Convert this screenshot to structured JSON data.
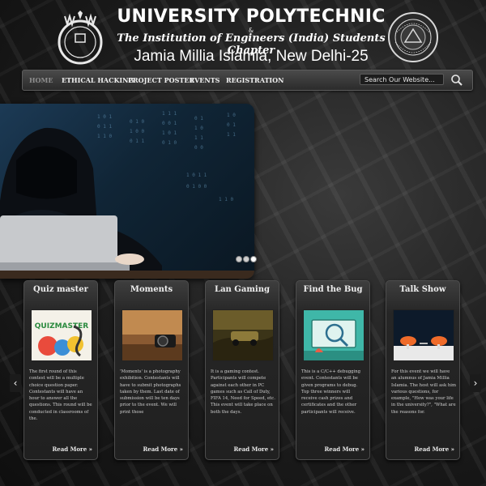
{
  "header": {
    "title": "UNIVERSITY POLYTECHNIC",
    "ampersand": "&",
    "subtitle": "The Institution of Engineers (India) Students Chapter",
    "location": "Jamia Millia Islamia, New Delhi-25"
  },
  "nav": {
    "items": [
      {
        "label": "HOME",
        "active": true
      },
      {
        "label": "ETHICAL HACKING",
        "active": false
      },
      {
        "label": "PROJECT POSTER",
        "active": false
      },
      {
        "label": "EVENTS",
        "active": false
      },
      {
        "label": "REGISTRATION",
        "active": false
      }
    ],
    "search_placeholder": "Search Our Website...",
    "search_icon": "magnifier-icon"
  },
  "slider": {
    "slide_count": 3,
    "active_slide": 3
  },
  "cards": [
    {
      "title": "Quiz master",
      "image_label": "QUIZMASTER",
      "description": "The first round of this contest will be a multiple choice question paper. Contestants will have an hour to answer all the questions. This round will be conducted in classrooms of the.",
      "read_more": "Read More »"
    },
    {
      "title": "Moments",
      "image_label": "",
      "description": "'Moments' is a photography exhibition. Contestants will have to submit photographs taken by them. Last date of submission will be ten days prior to the event. We will print those",
      "read_more": "Read More »"
    },
    {
      "title": "Lan Gaming",
      "image_label": "",
      "description": "It is a gaming contest. Participants will compete against each other in PC games such as Call of Duty, FIFA 14, Need for Speed, etc. This event will take place on both the days.",
      "read_more": "Read More »"
    },
    {
      "title": "Find the Bug",
      "image_label": "",
      "description": "This is a C/C++ debugging event. Contestants will be given programs to debug. Top three winners will receive cash prizes and certificates and the other participants will receive.",
      "read_more": "Read More »"
    },
    {
      "title": "Talk Show",
      "image_label": "",
      "description": "For this event we will have an alumnus of Jamia Millia Islamia. The host will ask him various questions, for example, \"How was your life in the university?\", \"What are the reasons for.",
      "read_more": "Read More »"
    }
  ],
  "carousel": {
    "prev_icon": "chevron-left-icon",
    "next_icon": "chevron-right-icon",
    "prev_glyph": "‹",
    "next_glyph": "›"
  }
}
